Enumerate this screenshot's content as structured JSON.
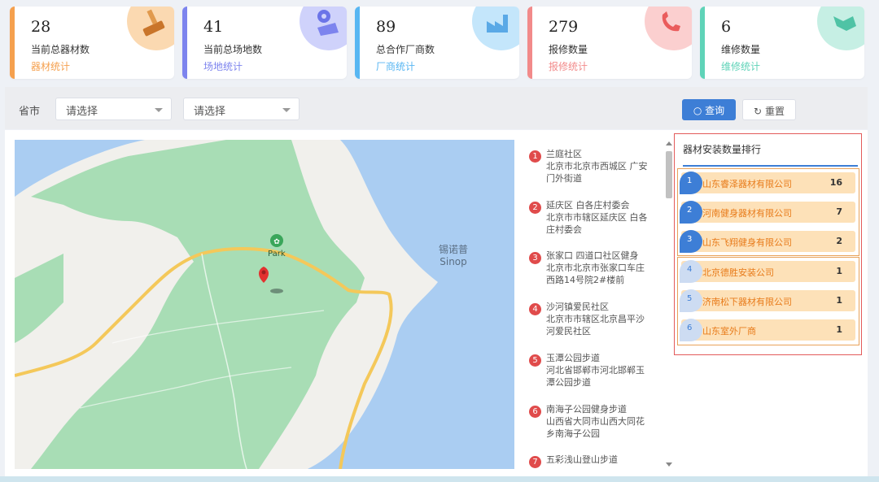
{
  "stats": [
    {
      "value": "28",
      "label": "当前总器材数",
      "link": "器材统计",
      "color": "#f5a04e",
      "icon": "hammer-icon"
    },
    {
      "value": "41",
      "label": "当前总场地数",
      "link": "场地统计",
      "color": "#7d84ee",
      "icon": "map-pin-icon"
    },
    {
      "value": "89",
      "label": "总合作厂商数",
      "link": "厂商统计",
      "color": "#58b6f2",
      "icon": "factory-icon"
    },
    {
      "value": "279",
      "label": "报修数量",
      "link": "报修统计",
      "color": "#f28a8a",
      "icon": "phone-icon"
    },
    {
      "value": "6",
      "label": "维修数量",
      "link": "维修统计",
      "color": "#5fd3b8",
      "icon": "wrench-icon"
    }
  ],
  "filter": {
    "label": "省市",
    "province_placeholder": "请选择",
    "city_placeholder": "请选择",
    "query_label": "查询",
    "reset_label": "重置"
  },
  "map": {
    "region_label_cn": "锡诺普",
    "region_label_en": "Sinop",
    "park_label": "Park"
  },
  "venues": [
    {
      "no": "1",
      "name": "兰庭社区",
      "address": "北京市北京市西城区 广安门外街道"
    },
    {
      "no": "2",
      "name": "延庆区 白各庄村委会",
      "address": "北京市市辖区延庆区 白各庄村委会"
    },
    {
      "no": "3",
      "name": "张家口 四道口社区健身",
      "address": "北京市北京市张家口车庄西路14号院2#楼前"
    },
    {
      "no": "4",
      "name": "沙河镇爱民社区",
      "address": "北京市市辖区北京昌平沙河爱民社区"
    },
    {
      "no": "5",
      "name": "玉潭公园步道",
      "address": "河北省邯郸市河北邯郸玉潭公园步道"
    },
    {
      "no": "6",
      "name": "南海子公园健身步道",
      "address": "山西省大同市山西大同花乡南海子公园"
    },
    {
      "no": "7",
      "name": "五彩浅山登山步道",
      "address": ""
    }
  ],
  "ranking": {
    "title": "器材安装数量排行",
    "items": [
      {
        "rank": "1",
        "name": "山东睿泽器材有限公司",
        "count": "16"
      },
      {
        "rank": "2",
        "name": "河南健身器材有限公司",
        "count": "7"
      },
      {
        "rank": "3",
        "name": "山东飞翔健身有限公司",
        "count": "2"
      },
      {
        "rank": "4",
        "name": "北京德胜安装公司",
        "count": "1"
      },
      {
        "rank": "5",
        "name": "济南松下器材有限公司",
        "count": "1"
      },
      {
        "rank": "6",
        "name": "山东室外厂商",
        "count": "1"
      }
    ]
  }
}
